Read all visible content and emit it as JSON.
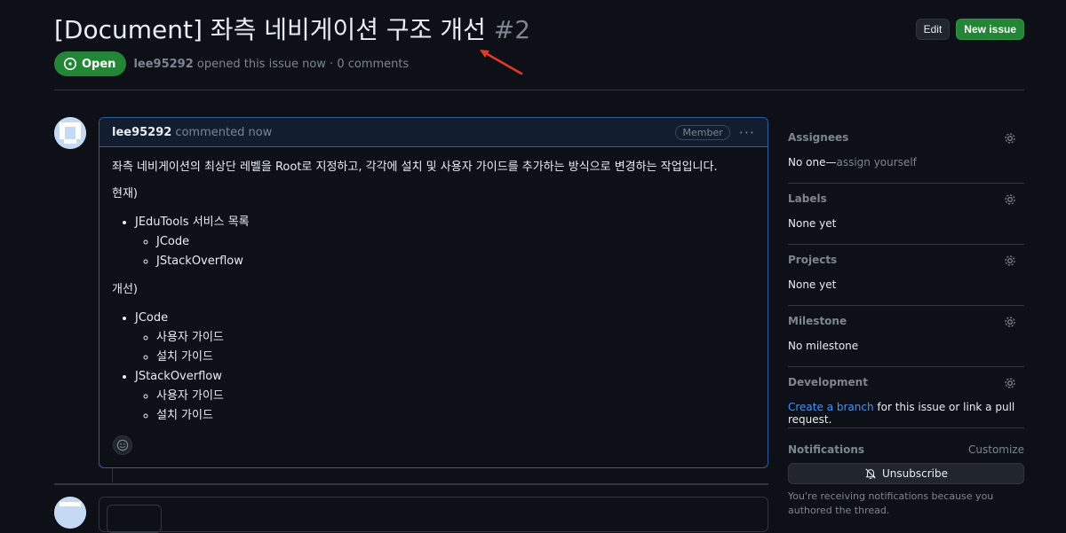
{
  "issue": {
    "title": "[Document] 좌측 네비게이션 구조 개선",
    "number": "#2",
    "state": "Open",
    "author": "lee95292",
    "meta": "opened this issue now · 0 comments"
  },
  "actions": {
    "edit": "Edit",
    "new_issue": "New issue"
  },
  "comment": {
    "author": "lee95292",
    "time": "commented now",
    "role": "Member",
    "intro": "좌측 네비게이션의 최상단 레벨을 Root로 지정하고, 각각에 설치 및 사용자 가이드를 추가하는 방식으로 변경하는 작업입니다.",
    "current_heading": "현재)",
    "current_list": {
      "item": "JEduTools 서비스 목록",
      "sub": [
        "JCode",
        "JStackOverflow"
      ]
    },
    "improved_heading": "개선)",
    "improved_list": [
      {
        "item": "JCode",
        "sub": [
          "사용자 가이드",
          "설치 가이드"
        ]
      },
      {
        "item": "JStackOverflow",
        "sub": [
          "사용자 가이드",
          "설치 가이드"
        ]
      }
    ]
  },
  "sidebar": {
    "assignees": {
      "title": "Assignees",
      "value": "No one—",
      "link": "assign yourself"
    },
    "labels": {
      "title": "Labels",
      "value": "None yet"
    },
    "projects": {
      "title": "Projects",
      "value": "None yet"
    },
    "milestone": {
      "title": "Milestone",
      "value": "No milestone"
    },
    "development": {
      "title": "Development",
      "link": "Create a branch",
      "rest": " for this issue or link a pull request."
    },
    "notifications": {
      "title": "Notifications",
      "customize": "Customize",
      "unsubscribe": "Unsubscribe",
      "note": "You're receiving notifications because you authored the thread."
    }
  },
  "colors": {
    "accent": "#4493f8",
    "open": "#238636",
    "background": "#0d1117",
    "annotation_arrow": "#e5382a"
  },
  "icons": [
    "issue-opened-icon",
    "kebab-horizontal-icon",
    "smiley-icon",
    "gear-icon",
    "bell-slash-icon",
    "arrow-annotation"
  ]
}
